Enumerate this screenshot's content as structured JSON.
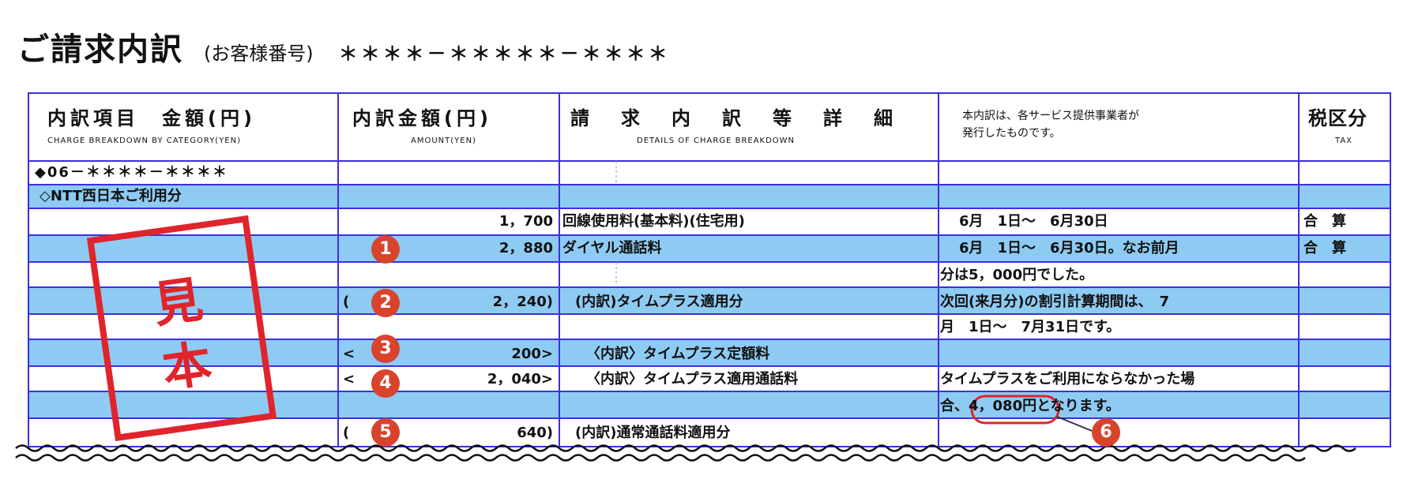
{
  "header": {
    "title": "ご請求内訳",
    "subtitle": "(お客様番号)",
    "customer_number": "＊＊＊＊－＊＊＊＊＊－＊＊＊＊"
  },
  "table": {
    "headers": {
      "category": "内訳項目　金額(円)",
      "category_en": "CHARGE BREAKDOWN BY CATEGORY(YEN)",
      "amount": "内訳金額(円)",
      "amount_en": "AMOUNT(YEN)",
      "details": "請求内訳等詳細",
      "details_en": "DETAILS OF CHARGE BREAKDOWN",
      "note_line1": "本内訳は、各サービス提供事業者が",
      "note_line2": "発行したものです。",
      "tax": "税区分",
      "tax_en": "TAX"
    },
    "account_line": "◆06－＊＊＊＊－＊＊＊＊",
    "provider_line": "◇NTT西日本ご利用分",
    "rows": [
      {
        "amount": "1，700",
        "item": "回線使用料(基本料)(住宅用)",
        "detail": "　6月　1日～　6月30日",
        "tax": "合　算"
      },
      {
        "amount": "2，880",
        "item": "ダイヤル通話料",
        "detail": "　6月　1日～　6月30日。なお前月",
        "tax": "合　算"
      },
      {
        "detail": "分は5，000円でした。"
      },
      {
        "open": "(",
        "amount": "2，240)",
        "item": "(内訳)タイムプラス適用分",
        "detail": "次回(来月分)の割引計算期間は、　7"
      },
      {
        "detail": "月　1日～　7月31日です。"
      },
      {
        "open": "<",
        "amount": "200>",
        "item": "〈内訳〉タイムプラス定額料"
      },
      {
        "open": "<",
        "amount": "2，040>",
        "item": "〈内訳〉タイムプラス適用通話料",
        "detail": "タイムプラスをご利用にならなかった場"
      },
      {
        "detail_a": "合、",
        "detail_b": "4，080円",
        "detail_c": "となります。"
      },
      {
        "open": "(",
        "amount": "640)",
        "item": "(内訳)通常通話料適用分"
      }
    ]
  },
  "stamp": {
    "char1": "見",
    "char2": "本"
  },
  "badges": [
    "1",
    "2",
    "3",
    "4",
    "5",
    "6"
  ],
  "colors": {
    "border": "#3b2fe0",
    "band": "#8ecbf3",
    "stamp": "#e0242b",
    "badge": "#d8432c"
  }
}
